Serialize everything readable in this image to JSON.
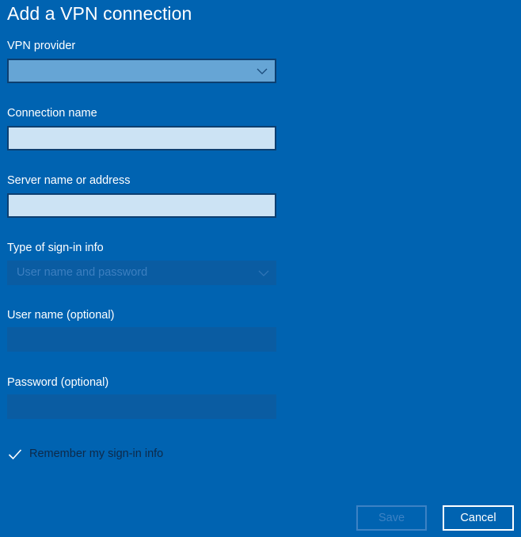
{
  "page": {
    "title": "Add a VPN connection"
  },
  "form": {
    "vpn_provider": {
      "label": "VPN provider",
      "value": ""
    },
    "connection_name": {
      "label": "Connection name",
      "value": "",
      "placeholder": ""
    },
    "server": {
      "label": "Server name or address",
      "value": "",
      "placeholder": ""
    },
    "sign_in_type": {
      "label": "Type of sign-in info",
      "value": "User name and password",
      "disabled": true
    },
    "username": {
      "label": "User name (optional)",
      "value": "",
      "disabled": true
    },
    "password": {
      "label": "Password (optional)",
      "value": "",
      "disabled": true
    },
    "remember": {
      "label": "Remember my sign-in info",
      "checked": true
    }
  },
  "buttons": {
    "save_label": "Save",
    "save_disabled": true,
    "cancel_label": "Cancel"
  },
  "icons": {
    "dropdown": "chevron-down-icon",
    "check": "checkmark-icon"
  },
  "colors": {
    "background": "#0063b1",
    "accent_text": "#ffffff",
    "disabled_text": "#3c82c4"
  }
}
